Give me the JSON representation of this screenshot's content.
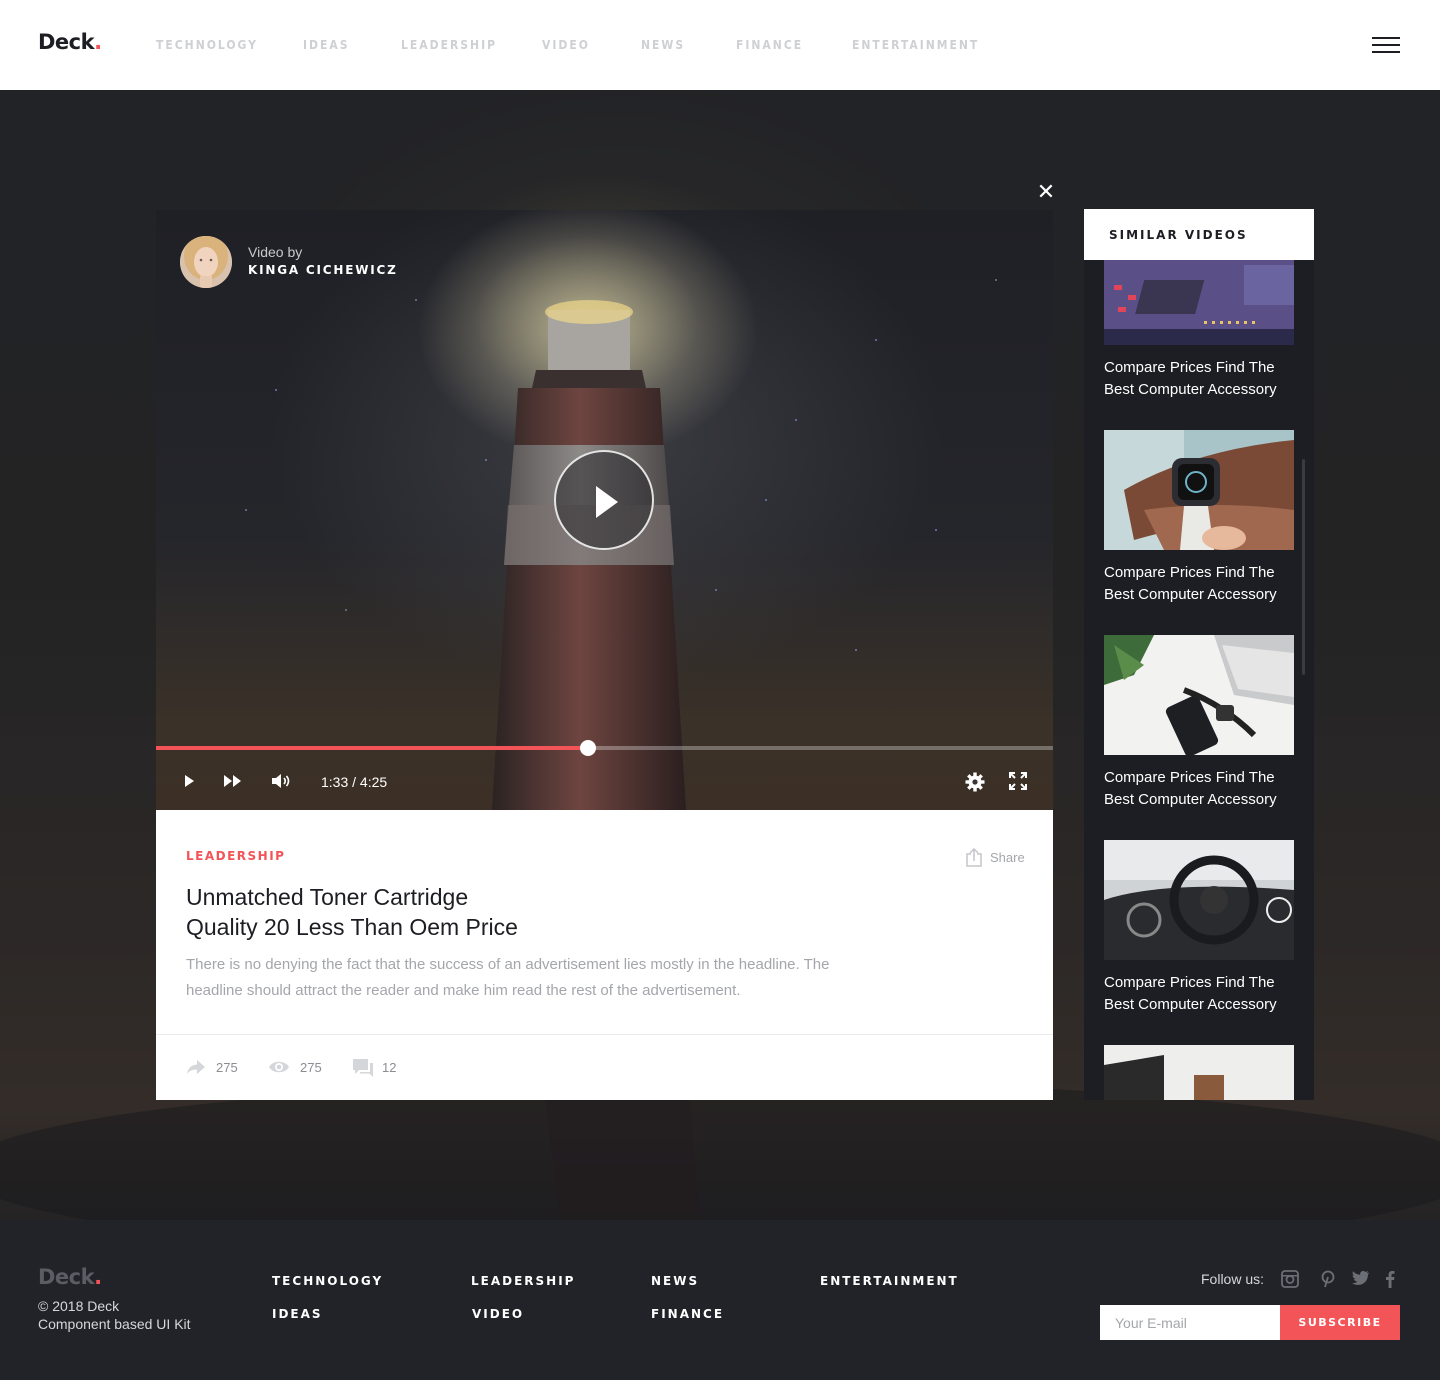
{
  "header": {
    "logo": "Deck",
    "logo_dot": ".",
    "nav": [
      "TECHNOLOGY",
      "IDEAS",
      "LEADERSHIP",
      "VIDEO",
      "NEWS",
      "FINANCE",
      "ENTERTAINMENT"
    ],
    "menu_icon": "hamburger-icon"
  },
  "modal": {
    "close_icon": "close-icon",
    "close_glyph": "✕"
  },
  "player": {
    "video_by": "Video by",
    "author_name": "KINGA CICHEWICZ",
    "time": "1:33 / 4:25",
    "progress": 0.482,
    "controls": [
      "play-icon",
      "fast-forward-icon",
      "volume-icon",
      "settings-icon",
      "fullscreen-icon"
    ]
  },
  "article": {
    "category": "LEADERSHIP",
    "share_label": "Share",
    "title_line1": "Unmatched Toner Cartridge",
    "title_line2": "Quality 20 Less Than Oem Price",
    "description": "There is no denying the fact that the success of an advertisement lies mostly in the headline. The headline should attract the reader and make him read the rest of the advertisement.",
    "stats": {
      "shares": "275",
      "views": "275",
      "comments": "12"
    }
  },
  "similar": {
    "title": "SIMILAR VIDEOS",
    "items": [
      {
        "line1": "Compare Prices Find The",
        "line2": "Best Computer Accessory"
      },
      {
        "line1": "Compare Prices Find The",
        "line2": "Best Computer Accessory"
      },
      {
        "line1": "Compare Prices Find The",
        "line2": "Best Computer Accessory"
      },
      {
        "line1": "Compare Prices Find The",
        "line2": "Best Computer Accessory"
      }
    ]
  },
  "footer": {
    "logo": "Deck",
    "logo_dot": ".",
    "copyright": "© 2018 Deck",
    "tagline": "Component based UI Kit",
    "links": {
      "technology": "TECHNOLOGY",
      "ideas": "IDEAS",
      "leadership": "LEADERSHIP",
      "video": "VIDEO",
      "news": "NEWS",
      "finance": "FINANCE",
      "entertainment": "ENTERTAINMENT"
    },
    "follow_label": "Follow us:",
    "social": [
      "instagram-icon",
      "pinterest-icon",
      "twitter-icon",
      "facebook-icon"
    ],
    "email_placeholder": "Your E-mail",
    "subscribe_label": "SUBSCRIBE"
  },
  "colors": {
    "accent": "#f25457",
    "dark": "#1d1e23",
    "footer_bg": "#222329",
    "nav_inactive": "#cfd0d3"
  }
}
